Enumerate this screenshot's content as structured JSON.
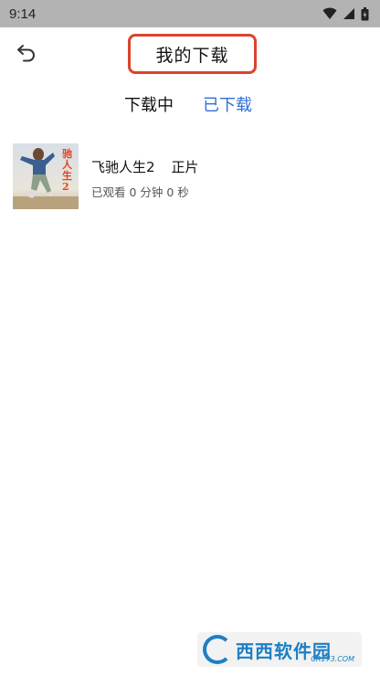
{
  "status_bar": {
    "time": "9:14",
    "icons": [
      "wifi-icon",
      "signal-icon",
      "battery-icon"
    ]
  },
  "header": {
    "title": "我的下载",
    "back_icon": "undo-arrow-icon",
    "highlight_color": "#d9452b"
  },
  "tabs": [
    {
      "label": "下载中",
      "active": false
    },
    {
      "label": "已下载",
      "active": true,
      "color": "#2f6fd6"
    }
  ],
  "downloads": [
    {
      "title": "飞驰人生2",
      "tag": "正片",
      "progress_text": "已观看 0 分钟 0 秒",
      "poster_text": "驰人生2"
    }
  ],
  "watermark": {
    "text": "西西软件园",
    "subtext": "CR173.COM"
  }
}
